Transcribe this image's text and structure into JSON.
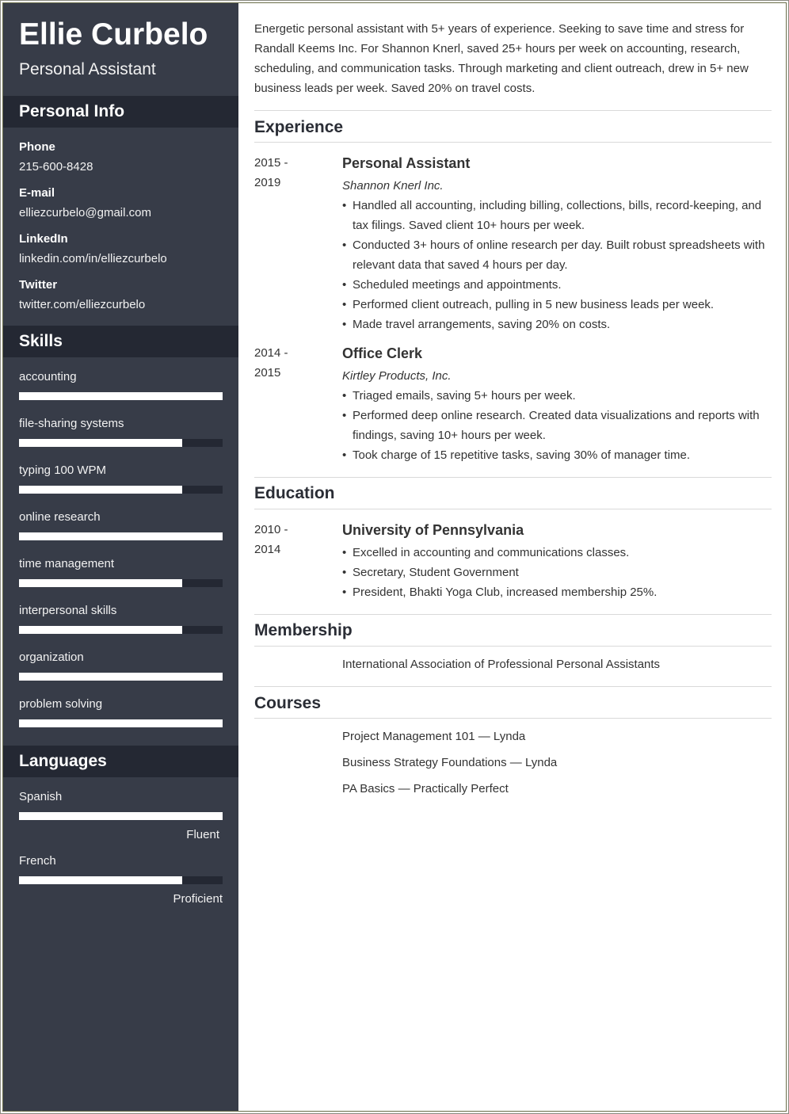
{
  "header": {
    "name": "Ellie Curbelo",
    "role": "Personal Assistant"
  },
  "colors": {
    "sidebar_bg": "#373c48",
    "sidebar_heading_bg": "#242833",
    "bar_fill": "#ffffff",
    "bar_track": "#242833",
    "text_main": "#333333",
    "divider": "#d9d9d9"
  },
  "personal_info": {
    "heading": "Personal Info",
    "items": [
      {
        "label": "Phone",
        "value": "215-600-8428"
      },
      {
        "label": "E-mail",
        "value": "elliezcurbelo@gmail.com"
      },
      {
        "label": "LinkedIn",
        "value": "linkedin.com/in/elliezcurbelo"
      },
      {
        "label": "Twitter",
        "value": "twitter.com/elliezcurbelo"
      }
    ]
  },
  "skills": {
    "heading": "Skills",
    "items": [
      {
        "name": "accounting",
        "level": 1.0
      },
      {
        "name": "file-sharing systems",
        "level": 0.8
      },
      {
        "name": "typing 100 WPM",
        "level": 0.8
      },
      {
        "name": "online research",
        "level": 1.0
      },
      {
        "name": "time management",
        "level": 0.8
      },
      {
        "name": "interpersonal skills",
        "level": 0.8
      },
      {
        "name": "organization",
        "level": 1.0
      },
      {
        "name": "problem solving",
        "level": 1.0
      }
    ]
  },
  "languages": {
    "heading": "Languages",
    "items": [
      {
        "name": "Spanish",
        "level": 1.0,
        "level_label": "Fluent"
      },
      {
        "name": "French",
        "level": 0.8,
        "level_label": "Proficient"
      }
    ]
  },
  "summary": "Energetic personal assistant with 5+ years of experience. Seeking to save time and stress for Randall Keems Inc. For Shannon Knerl, saved 25+ hours per week on accounting, research, scheduling, and communication tasks. Through marketing and client outreach, drew in 5+ new business leads per week. Saved 20% on travel costs.",
  "experience": {
    "heading": "Experience",
    "entries": [
      {
        "date_start": "2015 -",
        "date_end": "2019",
        "title": "Personal Assistant",
        "company": "Shannon Knerl Inc.",
        "bullets": [
          "Handled all accounting, including billing, collections, bills, record-keeping, and tax filings. Saved client 10+ hours per week.",
          "Conducted 3+ hours of online research per day. Built robust spreadsheets with relevant data that saved 4 hours per day.",
          "Scheduled meetings and appointments.",
          "Performed client outreach, pulling in 5 new business leads per week.",
          "Made travel arrangements, saving 20% on costs."
        ]
      },
      {
        "date_start": "2014 -",
        "date_end": "2015",
        "title": "Office Clerk",
        "company": "Kirtley Products, Inc.",
        "bullets": [
          "Triaged emails, saving 5+ hours per week.",
          "Performed deep online research. Created data visualizations and reports with findings, saving 10+ hours per week.",
          "Took charge of 15 repetitive tasks, saving 30% of manager time."
        ]
      }
    ]
  },
  "education": {
    "heading": "Education",
    "entries": [
      {
        "date_start": "2010 -",
        "date_end": "2014",
        "title": "University of Pennsylvania",
        "bullets": [
          "Excelled in accounting and communications classes.",
          "Secretary, Student Government",
          "President, Bhakti Yoga Club, increased membership 25%."
        ]
      }
    ]
  },
  "membership": {
    "heading": "Membership",
    "items": [
      "International Association of Professional Personal Assistants"
    ]
  },
  "courses": {
    "heading": "Courses",
    "items": [
      "Project Management 101 — Lynda",
      "Business Strategy Foundations — Lynda",
      "PA Basics — Practically Perfect"
    ]
  }
}
